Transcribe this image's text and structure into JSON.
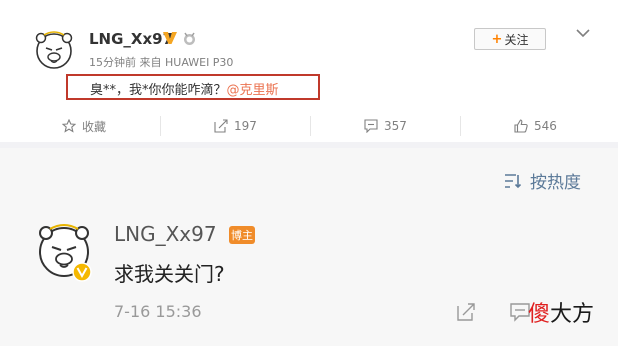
{
  "post": {
    "username": "LNG_Xx97",
    "meta": "15分钟前 来自 HUAWEI P30",
    "follow_label": "关注",
    "follow_plus": "+",
    "text": "臭**，我*你你能咋滴？",
    "mention": "@克里斯"
  },
  "actions": {
    "favorite_label": "收藏",
    "repost_count": "197",
    "comment_count": "357",
    "like_count": "546"
  },
  "comments": {
    "sort_label": "按热度",
    "items": [
      {
        "username": "LNG_Xx97",
        "tag": "博主",
        "text": "求我关关门?",
        "time": "7-16 15:36"
      }
    ]
  },
  "watermark": {
    "part1": "傻",
    "part2": "大方"
  },
  "colors": {
    "accent_orange": "#ff8200",
    "mention": "#eb7350",
    "highlight_box": "#c0392b",
    "sort_blue": "#5c7a99",
    "tag_orange": "#f08c2a"
  }
}
